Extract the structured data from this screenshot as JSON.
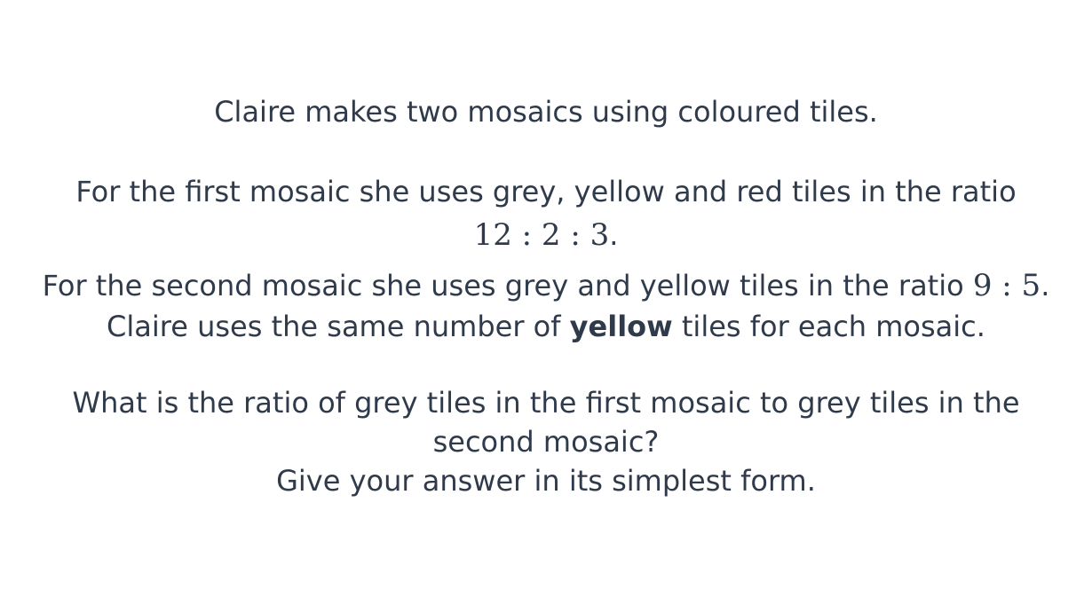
{
  "question": {
    "intro": "Claire makes two mosaics using coloured tiles.",
    "first_mosaic_text": "For the first mosaic she uses grey, yellow and red tiles in the ratio",
    "first_ratio": "12 : 2 : 3",
    "first_ratio_end": ".",
    "second_mosaic_text": "For the second mosaic she uses grey and yellow tiles in the ratio ",
    "second_ratio": "9 : 5",
    "second_ratio_end": ".",
    "same_yellow_before": "Claire uses the same number of ",
    "same_yellow_bold": "yellow",
    "same_yellow_after": " tiles for each mosaic.",
    "question_line_1": "What is the ratio of grey tiles in the first mosaic to grey tiles in the",
    "question_line_2": "second mosaic?",
    "instruction": "Give your answer in its simplest form."
  }
}
